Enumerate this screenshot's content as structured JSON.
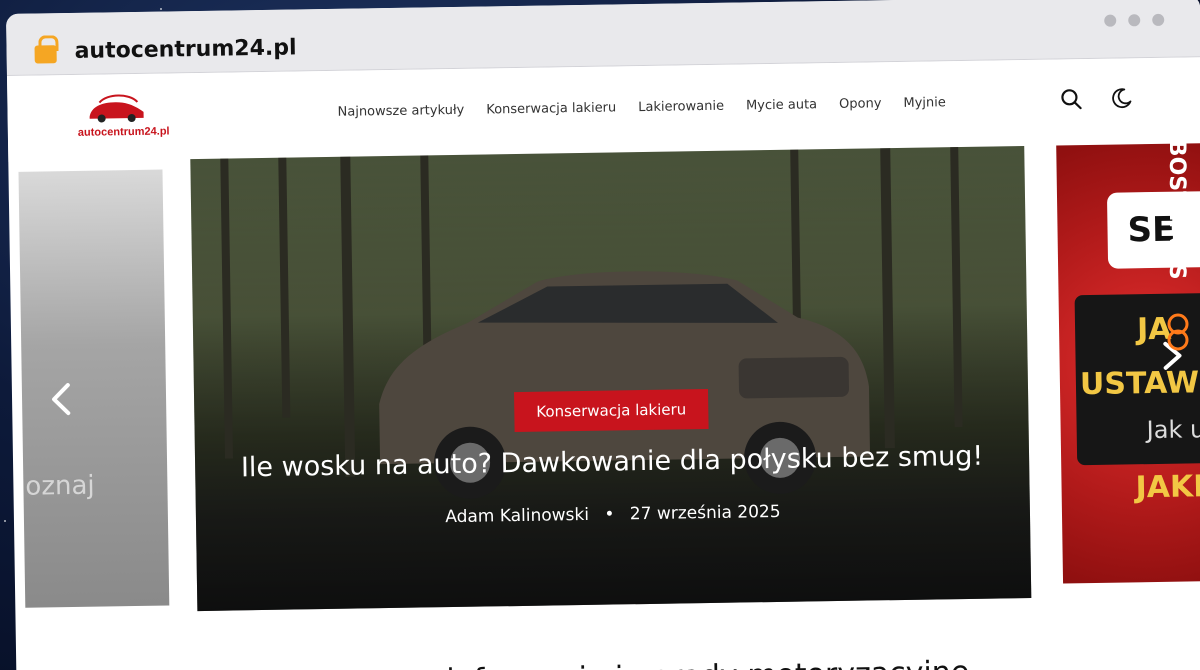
{
  "browser": {
    "url": "autocentrum24.pl"
  },
  "site": {
    "logo_text": "autocentrum24.pl",
    "nav": [
      "Najnowsze artykuły",
      "Konserwacja lakieru",
      "Lakierowanie",
      "Mycie auta",
      "Opony",
      "Myjnie"
    ]
  },
  "slider": {
    "left_partial_text": "oznaj",
    "main": {
      "category": "Konserwacja lakieru",
      "title": "Ile wosku na auto? Dawkowanie dla połysku bez smug!",
      "author": "Adam Kalinowski",
      "separator": "•",
      "date": "27 września 2025"
    },
    "right_partial": {
      "line1": "SE",
      "line2": "JA",
      "line3": "USTAWIE",
      "line4": "Jak u",
      "line5": "JAKI"
    }
  },
  "below_heading_partial": "informacje i porady motoryzacyjne",
  "watermark": {
    "text": "GUESTBOSTLINKS"
  },
  "colors": {
    "brand_red": "#c8141d",
    "lock": "#f5a623"
  }
}
